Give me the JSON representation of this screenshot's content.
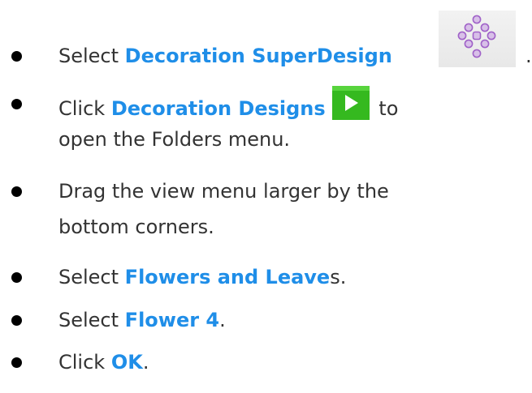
{
  "steps": [
    {
      "before": "Select ",
      "highlight": "Decoration SuperDesign",
      "after": "."
    },
    {
      "before": "Click ",
      "highlight": "Decoration Designs",
      "after": " to",
      "line2": "open the Folders menu."
    },
    {
      "line1": "Drag the view menu larger by the",
      "line2": "bottom corners."
    },
    {
      "before": "Select ",
      "highlight": "Flowers and Leave",
      "after": "s."
    },
    {
      "before": "Select ",
      "highlight": "Flower 4",
      "after": "."
    },
    {
      "before": "Click ",
      "highlight": "OK",
      "after": "."
    }
  ],
  "icons": {
    "superdesign": "decoration-superdesign-icon",
    "designs": "play-icon",
    "highlight_color": "#1f8ee8",
    "play_color": "#2fbf1f"
  }
}
